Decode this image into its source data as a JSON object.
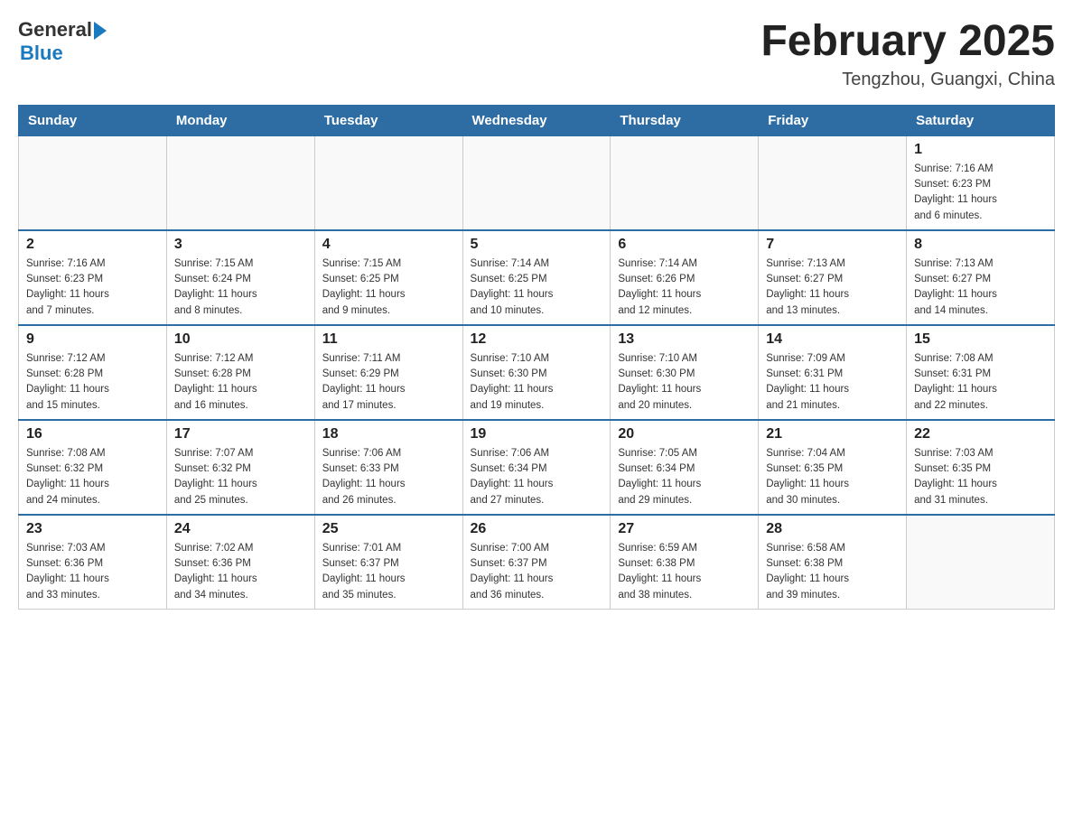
{
  "header": {
    "logo_general": "General",
    "logo_blue": "Blue",
    "title": "February 2025",
    "subtitle": "Tengzhou, Guangxi, China"
  },
  "weekdays": [
    "Sunday",
    "Monday",
    "Tuesday",
    "Wednesday",
    "Thursday",
    "Friday",
    "Saturday"
  ],
  "weeks": [
    [
      {
        "day": "",
        "info": ""
      },
      {
        "day": "",
        "info": ""
      },
      {
        "day": "",
        "info": ""
      },
      {
        "day": "",
        "info": ""
      },
      {
        "day": "",
        "info": ""
      },
      {
        "day": "",
        "info": ""
      },
      {
        "day": "1",
        "info": "Sunrise: 7:16 AM\nSunset: 6:23 PM\nDaylight: 11 hours\nand 6 minutes."
      }
    ],
    [
      {
        "day": "2",
        "info": "Sunrise: 7:16 AM\nSunset: 6:23 PM\nDaylight: 11 hours\nand 7 minutes."
      },
      {
        "day": "3",
        "info": "Sunrise: 7:15 AM\nSunset: 6:24 PM\nDaylight: 11 hours\nand 8 minutes."
      },
      {
        "day": "4",
        "info": "Sunrise: 7:15 AM\nSunset: 6:25 PM\nDaylight: 11 hours\nand 9 minutes."
      },
      {
        "day": "5",
        "info": "Sunrise: 7:14 AM\nSunset: 6:25 PM\nDaylight: 11 hours\nand 10 minutes."
      },
      {
        "day": "6",
        "info": "Sunrise: 7:14 AM\nSunset: 6:26 PM\nDaylight: 11 hours\nand 12 minutes."
      },
      {
        "day": "7",
        "info": "Sunrise: 7:13 AM\nSunset: 6:27 PM\nDaylight: 11 hours\nand 13 minutes."
      },
      {
        "day": "8",
        "info": "Sunrise: 7:13 AM\nSunset: 6:27 PM\nDaylight: 11 hours\nand 14 minutes."
      }
    ],
    [
      {
        "day": "9",
        "info": "Sunrise: 7:12 AM\nSunset: 6:28 PM\nDaylight: 11 hours\nand 15 minutes."
      },
      {
        "day": "10",
        "info": "Sunrise: 7:12 AM\nSunset: 6:28 PM\nDaylight: 11 hours\nand 16 minutes."
      },
      {
        "day": "11",
        "info": "Sunrise: 7:11 AM\nSunset: 6:29 PM\nDaylight: 11 hours\nand 17 minutes."
      },
      {
        "day": "12",
        "info": "Sunrise: 7:10 AM\nSunset: 6:30 PM\nDaylight: 11 hours\nand 19 minutes."
      },
      {
        "day": "13",
        "info": "Sunrise: 7:10 AM\nSunset: 6:30 PM\nDaylight: 11 hours\nand 20 minutes."
      },
      {
        "day": "14",
        "info": "Sunrise: 7:09 AM\nSunset: 6:31 PM\nDaylight: 11 hours\nand 21 minutes."
      },
      {
        "day": "15",
        "info": "Sunrise: 7:08 AM\nSunset: 6:31 PM\nDaylight: 11 hours\nand 22 minutes."
      }
    ],
    [
      {
        "day": "16",
        "info": "Sunrise: 7:08 AM\nSunset: 6:32 PM\nDaylight: 11 hours\nand 24 minutes."
      },
      {
        "day": "17",
        "info": "Sunrise: 7:07 AM\nSunset: 6:32 PM\nDaylight: 11 hours\nand 25 minutes."
      },
      {
        "day": "18",
        "info": "Sunrise: 7:06 AM\nSunset: 6:33 PM\nDaylight: 11 hours\nand 26 minutes."
      },
      {
        "day": "19",
        "info": "Sunrise: 7:06 AM\nSunset: 6:34 PM\nDaylight: 11 hours\nand 27 minutes."
      },
      {
        "day": "20",
        "info": "Sunrise: 7:05 AM\nSunset: 6:34 PM\nDaylight: 11 hours\nand 29 minutes."
      },
      {
        "day": "21",
        "info": "Sunrise: 7:04 AM\nSunset: 6:35 PM\nDaylight: 11 hours\nand 30 minutes."
      },
      {
        "day": "22",
        "info": "Sunrise: 7:03 AM\nSunset: 6:35 PM\nDaylight: 11 hours\nand 31 minutes."
      }
    ],
    [
      {
        "day": "23",
        "info": "Sunrise: 7:03 AM\nSunset: 6:36 PM\nDaylight: 11 hours\nand 33 minutes."
      },
      {
        "day": "24",
        "info": "Sunrise: 7:02 AM\nSunset: 6:36 PM\nDaylight: 11 hours\nand 34 minutes."
      },
      {
        "day": "25",
        "info": "Sunrise: 7:01 AM\nSunset: 6:37 PM\nDaylight: 11 hours\nand 35 minutes."
      },
      {
        "day": "26",
        "info": "Sunrise: 7:00 AM\nSunset: 6:37 PM\nDaylight: 11 hours\nand 36 minutes."
      },
      {
        "day": "27",
        "info": "Sunrise: 6:59 AM\nSunset: 6:38 PM\nDaylight: 11 hours\nand 38 minutes."
      },
      {
        "day": "28",
        "info": "Sunrise: 6:58 AM\nSunset: 6:38 PM\nDaylight: 11 hours\nand 39 minutes."
      },
      {
        "day": "",
        "info": ""
      }
    ]
  ]
}
